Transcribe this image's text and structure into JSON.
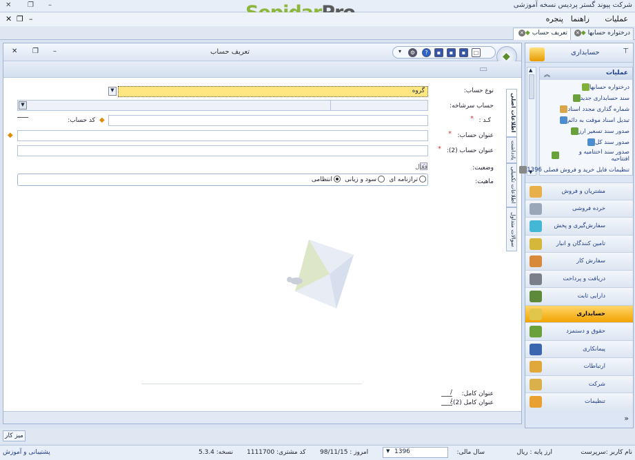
{
  "window": {
    "company_title": "شرکت پیوند گستر پردیس نسخه آموزشی",
    "brand_part1": "Sepidar",
    "brand_part2": "Pro"
  },
  "menubar": {
    "items": [
      "عملیات",
      "راهنما",
      "پنجره"
    ]
  },
  "doc_tabs": [
    {
      "label": "درختواره حسابها"
    },
    {
      "label": "تعریف حساب"
    }
  ],
  "form": {
    "title": "تعریف حساب",
    "fields": {
      "account_type_label": "نوع حساب:",
      "account_type_value": "گروه",
      "parent_label": "حساب سرشاخه:",
      "code_label": "کـد :",
      "account_code_label": "کد حساب:",
      "title_label": "عنوان حساب:",
      "title2_label": "عنوان حساب (2):",
      "status_label": "وضعیت:",
      "active_label": "فعال",
      "nature_label": "ماهیت:",
      "nature_options": [
        "ترازنامه ای",
        "سود و زیانی",
        "انتظامی"
      ],
      "fulltitle_label": "عنوان کامل:",
      "fulltitle2_label": "عنوان کامل (2):",
      "fulltitle_value": "/",
      "fulltitle2_value": "/"
    },
    "vtabs": [
      "اطلاعات اصلی",
      "یادداشت",
      "اطلاعات تکمیلی",
      "سوالات متداول"
    ]
  },
  "side": {
    "title": "حسابداری",
    "ops_title": "عملیات",
    "ops_items": [
      "درختواره حسابها",
      "سند حسابداری جدید",
      "شماره گذاری مجدد اسناد",
      "تبدیل اسناد موقت به دائم",
      "صدور سند تسعیر ارز",
      "صدور سند کل",
      "صدور سند اختتامیه و افتتاحیه",
      "تنظیمات فایل خرید و فروش فصلی 1396"
    ],
    "nav": [
      "مشتریان و فروش",
      "خرده فروشی",
      "سفارش‌گیری و پخش",
      "تامین کنندگان و انبار",
      "سفارش کار",
      "دریافت و پرداخت",
      "دارایی ثابت",
      "حسابداری",
      "حقوق و دستمزد",
      "پیمانکاری",
      "ارتباطات",
      "شرکت",
      "تنظیمات"
    ],
    "nav_active": "حسابداری"
  },
  "taskbar": {
    "button": "میز کار"
  },
  "status": {
    "user": "نام کاربر :سرپرست",
    "base_currency": "ارز پایه : ریال",
    "fiscal_year_label": "سال مالی:",
    "fiscal_year": "1396",
    "today": "امروز : 98/11/15",
    "customer_code": "کد مشتری: 1111700",
    "version": "نسخه: 5.3.4",
    "support": "پشتیبانی و آموزش"
  },
  "colors": {
    "accent": "#f2a300",
    "brand_green": "#8cb63c",
    "highlight_input": "#ffe680"
  }
}
